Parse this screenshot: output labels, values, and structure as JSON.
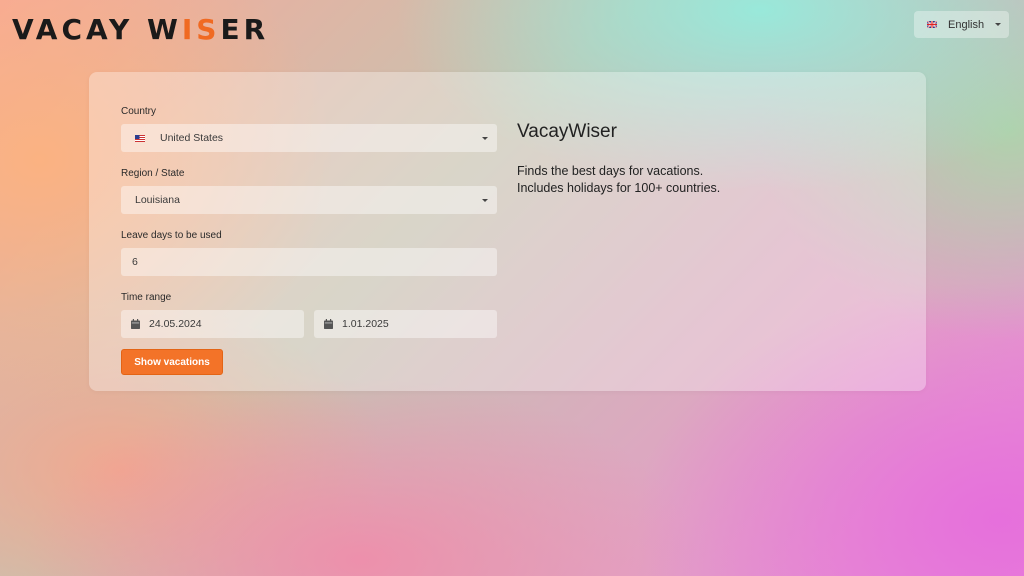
{
  "brand": {
    "logo_part1": "VACAY W",
    "logo_accent": "IS",
    "logo_part2": "ER",
    "accent_color": "#f06a22"
  },
  "language_selector": {
    "flag": "uk-flag-icon",
    "selected": "English"
  },
  "form": {
    "country": {
      "label": "Country",
      "flag": "us-flag-icon",
      "value": "United States"
    },
    "region": {
      "label": "Region / State",
      "value": "Louisiana"
    },
    "leave_days": {
      "label": "Leave days to be used",
      "value": "6"
    },
    "time_range": {
      "label": "Time range",
      "start": "24.05.2024",
      "end": "1.01.2025"
    },
    "submit_label": "Show vacations",
    "button_color": "#f37328"
  },
  "info": {
    "title": "VacayWiser",
    "line1": "Finds the best days for vacations.",
    "line2": "Includes holidays for 100+ countries."
  }
}
